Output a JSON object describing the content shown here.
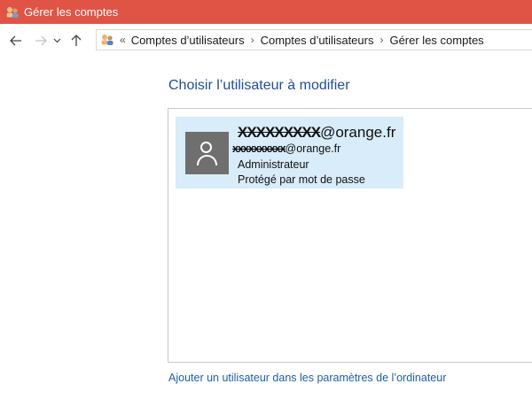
{
  "window": {
    "title": "Gérer les comptes"
  },
  "nav": {
    "back_icon": "arrow-left-icon",
    "forward_icon": "arrow-right-icon",
    "recent_icon": "chevron-down-icon",
    "up_icon": "arrow-up-icon"
  },
  "address": {
    "overflow": "«",
    "crumbs": [
      "Comptes d’utilisateurs",
      "Comptes d’utilisateurs",
      "Gérer les comptes"
    ],
    "separator": "›"
  },
  "main": {
    "heading": "Choisir l’utilisateur à modifier",
    "user": {
      "email_redacted": "XXXXXXXXX",
      "email_domain": "@orange.fr",
      "email2_redacted": "xxxxxxxxxx",
      "email2_domain": "@orange.fr",
      "role": "Administrateur",
      "status": "Protégé par mot de passe"
    },
    "add_user_link": "Ajouter un utilisateur dans les paramètres de l’ordinateur"
  },
  "colors": {
    "titlebar": "#e05445",
    "heading": "#1f4e97",
    "card": "#d8ecf9",
    "link": "#1f5fa8"
  }
}
